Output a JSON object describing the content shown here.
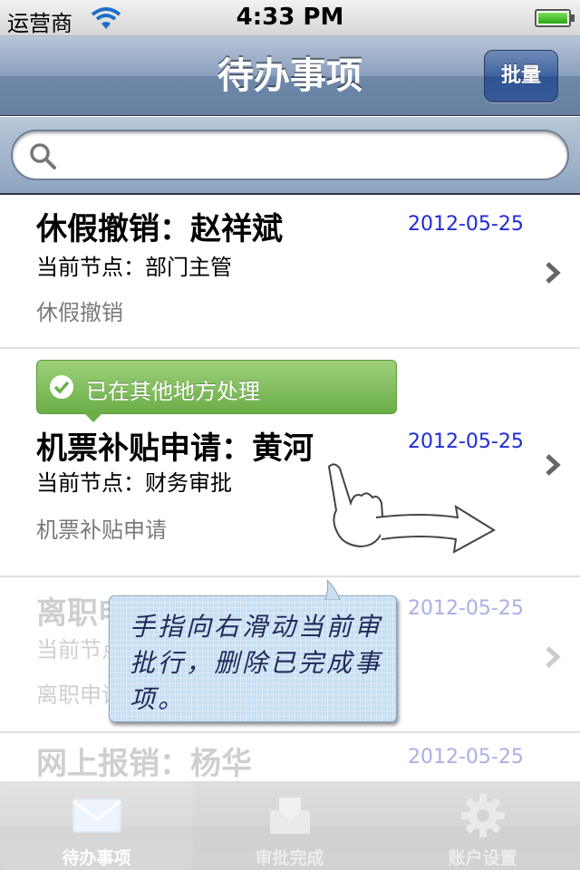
{
  "status": {
    "carrier": "运营商",
    "time": "4:33 PM"
  },
  "nav": {
    "title": "待办事项",
    "batch_label": "批量"
  },
  "search": {
    "placeholder": "",
    "value": ""
  },
  "rows": [
    {
      "title": "休假撤销：赵祥斌",
      "date": "2012-05-25",
      "node": "当前节点：部门主管",
      "type": "休假撤销"
    },
    {
      "title": "机票补贴申请：黄河",
      "date": "2012-05-25",
      "node": "当前节点：财务审批",
      "type": "机票补贴申请"
    },
    {
      "title": "离职申请：李智",
      "date": "2012-05-25",
      "node": "当前节点：人事审批",
      "type": "离职申请"
    },
    {
      "title": "网上报销：杨华",
      "date": "2012-05-25"
    }
  ],
  "badge": {
    "text": "已在其他地方处理"
  },
  "tip": {
    "text": "手指向右滑动当前审批行，删除已完成事项。"
  },
  "tabs": [
    {
      "label": "待办事项",
      "icon": "envelope-icon"
    },
    {
      "label": "审批完成",
      "icon": "tray-icon"
    },
    {
      "label": "账户设置",
      "icon": "gear-icon"
    }
  ],
  "colors": {
    "date": "#1f2bd8",
    "badge_green": "#6bae48",
    "nav_blue": "#6e88a9"
  }
}
